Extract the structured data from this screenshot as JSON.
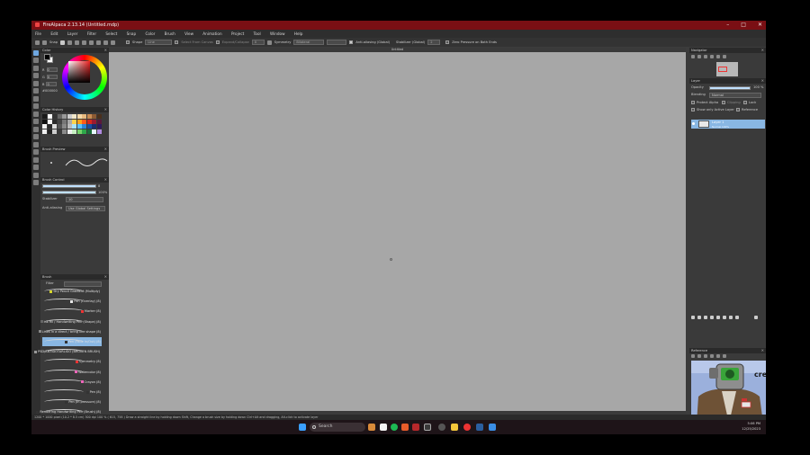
{
  "window": {
    "title": "FireAlpaca 2.13.14 (Untitled.mdp)",
    "buttons": [
      "–",
      "□",
      "✕"
    ]
  },
  "menu": [
    "File",
    "Edit",
    "Layer",
    "Filter",
    "Select",
    "Snap",
    "Color",
    "Brush",
    "View",
    "Animation",
    "Project",
    "Tool",
    "Window",
    "Help"
  ],
  "toolbar": {
    "snap_label": "Snap",
    "shape_label": "Shape",
    "shape_value": "Line",
    "select_from_canvas": "Select From Canvas",
    "expand_fill": "Expand/Collapse",
    "expand_value": "0",
    "symmetry_label": "Symmetry",
    "symmetry_value": "Bilateral",
    "anti_aliasing": "Anti-aliasing (Global)",
    "stabilizer_label": "Stabilizer (Global)",
    "stabilizer_value": "2",
    "zero_pressure": "Zero Pressure on Both Ends"
  },
  "color_panel": {
    "title": "Color",
    "r": "0",
    "g": "0",
    "b": "0",
    "hex": "#000000"
  },
  "history_panel": {
    "title": "Color History"
  },
  "preview_panel": {
    "title": "Brush Preview"
  },
  "control_panel": {
    "title": "Brush Control",
    "size_value": "8",
    "opacity_value": "100%",
    "stabilizer_label": "Stabilizer",
    "stabilizer_value": "10",
    "aa_label": "Anti-aliasing",
    "aa_value": "Use Global Settings"
  },
  "brush_panel": {
    "title": "Brush",
    "filter_label": "Filter",
    "items": [
      {
        "name": "Dry Pencil Gradient (Multiply)",
        "size": ""
      },
      {
        "name": "Pen (Overlay)",
        "size": "(8)"
      },
      {
        "name": "Marker",
        "size": "(8)"
      },
      {
        "name": "ink fill / Handwriting Pen (Shape)",
        "size": "(8)"
      },
      {
        "name": "Lines in a direct / bring line shape",
        "size": "(8)"
      },
      {
        "name": "Pen (Fade In/Out)",
        "size": "(8)"
      },
      {
        "name": "PSD/ANTIDOTARLIGO (BROKEN BRUSH)",
        "size": ""
      },
      {
        "name": "Symmetry",
        "size": "(8)"
      },
      {
        "name": "Watercolor",
        "size": "(8)"
      },
      {
        "name": "Crayon",
        "size": "(8)"
      },
      {
        "name": "Pen",
        "size": "(8)"
      },
      {
        "name": "Pen (In pressure)",
        "size": "(8)"
      },
      {
        "name": "Rendering Handwriting Pen (Brush)",
        "size": "(8)"
      }
    ]
  },
  "canvas": {
    "tab_title": "Untitled"
  },
  "navigator_panel": {
    "title": "Navigator"
  },
  "layer_panel": {
    "title": "Layer",
    "opacity_label": "Opacity",
    "opacity_value": "100 %",
    "blending_label": "Blending",
    "blending_value": "Normal",
    "protect_alpha": "Protect Alpha",
    "clipping": "Clipping",
    "lock": "Lock",
    "show_only_active": "Show only Active Layer",
    "reference": "Reference",
    "layers": [
      {
        "name": "Layer 1",
        "sub": "Normal 100%"
      }
    ]
  },
  "reference_panel": {
    "title": "Reference",
    "cam_text": "cre"
  },
  "statusbar": "1200 * 1000 pixel  (10.2 * 8.5 cm)  300 dpi  100 %  ( 615, 758 )   Draw a straight line by holding down Shift, Change a brush size by holding down Ctrl+Alt and dragging, Alt-click to activate layer",
  "taskbar": {
    "search_placeholder": "Search",
    "time": "5:06 PM",
    "date": "12/25/2023"
  }
}
